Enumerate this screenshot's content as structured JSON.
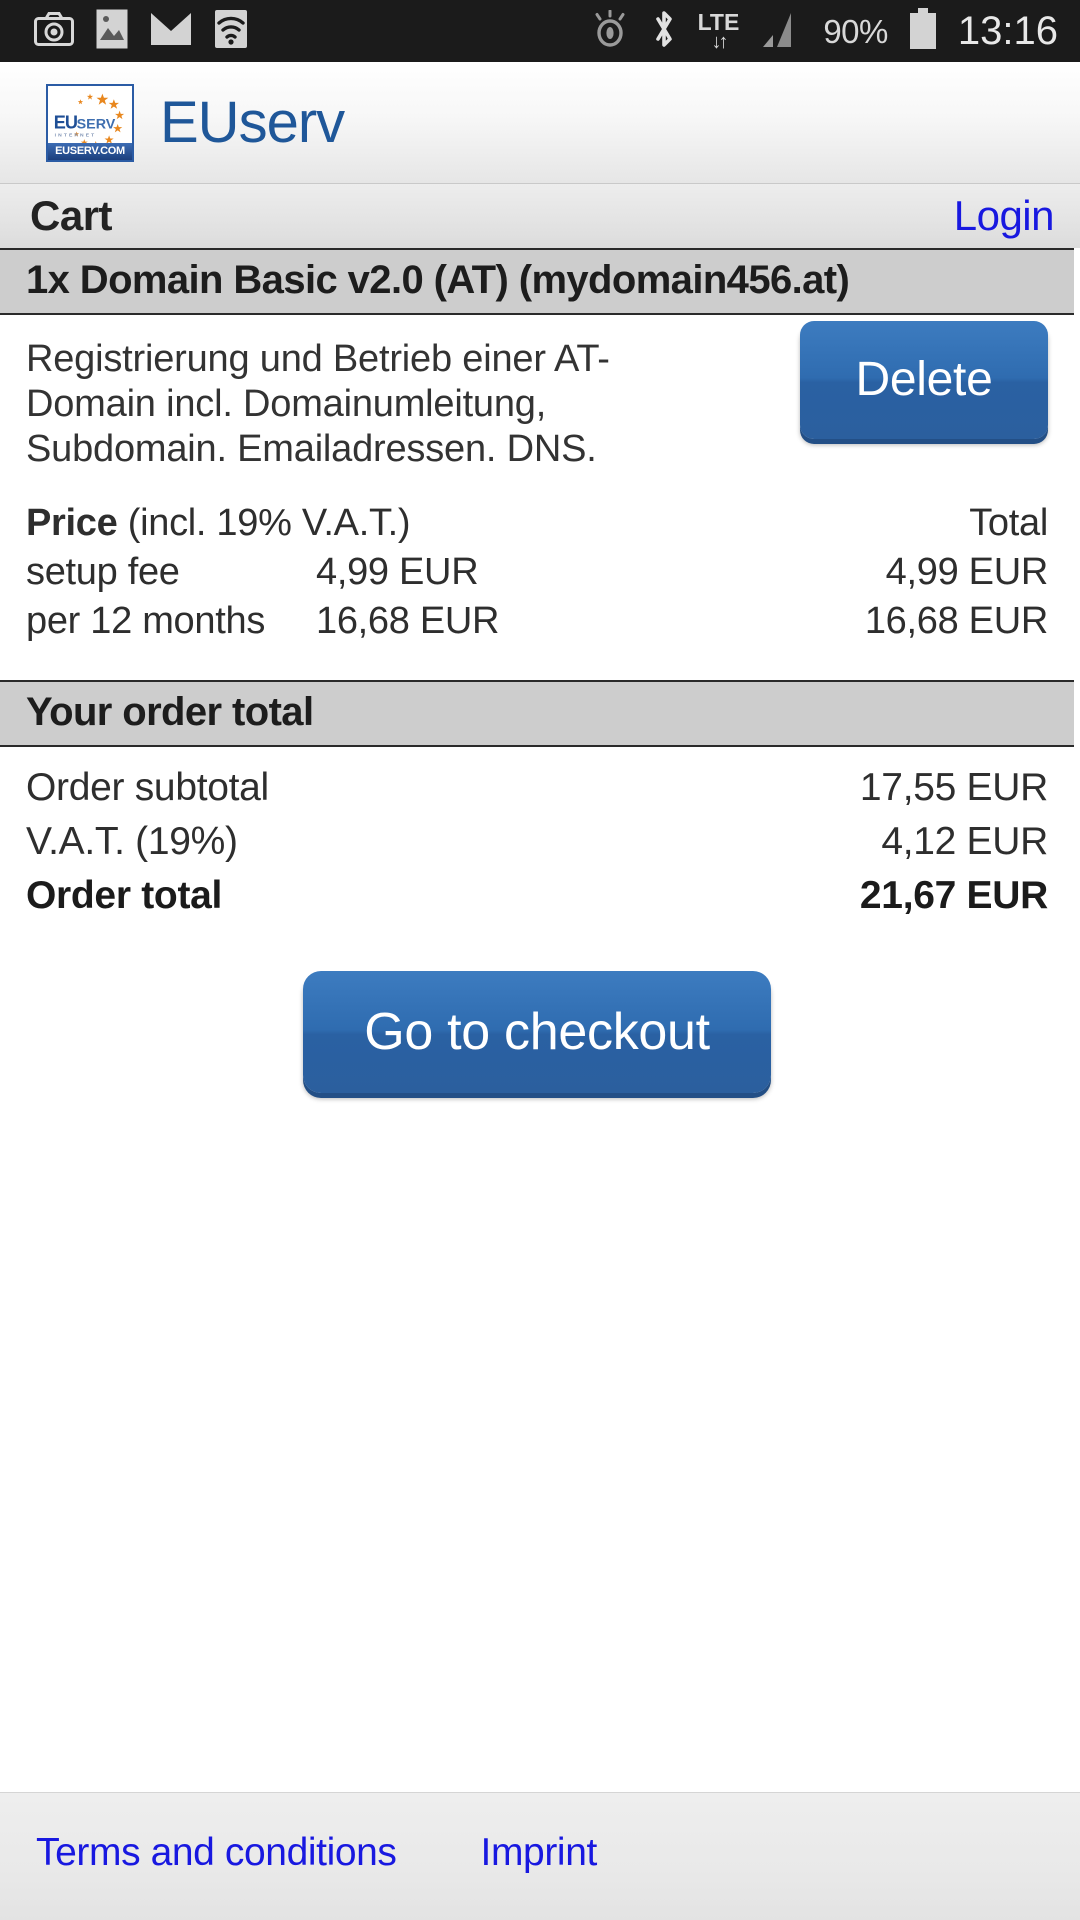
{
  "statusbar": {
    "time": "13:16",
    "battery_percent": "90%",
    "network": "LTE",
    "left_icons": [
      "camera-icon",
      "image-icon",
      "mail-icon",
      "wifi-icon"
    ],
    "right_icons": [
      "eye-off-icon",
      "bluetooth-icon",
      "lte-icon",
      "signal-icon",
      "battery-icon"
    ]
  },
  "header": {
    "brand": "EUserv",
    "logo_text": "EUSERV",
    "logo_subtext": "INTERNET",
    "logo_domain": "EUSERV.COM"
  },
  "navbar": {
    "title": "Cart",
    "login": "Login"
  },
  "cart": {
    "item": {
      "title": "1x Domain Basic v2.0 (AT) (mydomain456.at)",
      "description": "Registrierung und Betrieb einer AT-Domain incl. Domainumleitung, Subdomain. Emailadressen. DNS.",
      "delete_label": "Delete",
      "price_header": {
        "label": "Price",
        "note": "(incl. 19% V.A.T.)",
        "total": "Total"
      },
      "lines": [
        {
          "label": "setup fee",
          "amount": "4,99 EUR",
          "total": "4,99 EUR"
        },
        {
          "label": "per 12 months",
          "amount": "16,68 EUR",
          "total": "16,68 EUR"
        }
      ]
    },
    "order_total": {
      "heading": "Your order total",
      "rows": [
        {
          "label": "Order subtotal",
          "value": "17,55 EUR"
        },
        {
          "label": "V.A.T. (19%)",
          "value": "4,12 EUR"
        }
      ],
      "grand": {
        "label": "Order total",
        "value": "21,67 EUR"
      }
    },
    "checkout_label": "Go to checkout"
  },
  "footer": {
    "links": [
      {
        "label": "Terms and conditions"
      },
      {
        "label": "Imprint"
      }
    ]
  },
  "colors": {
    "brand_blue": "#1f5799",
    "link_blue": "#1818e0",
    "button_blue": "#2f6cb0",
    "section_grey": "#cdcdcd",
    "statusbar_black": "#1b1b1b"
  }
}
